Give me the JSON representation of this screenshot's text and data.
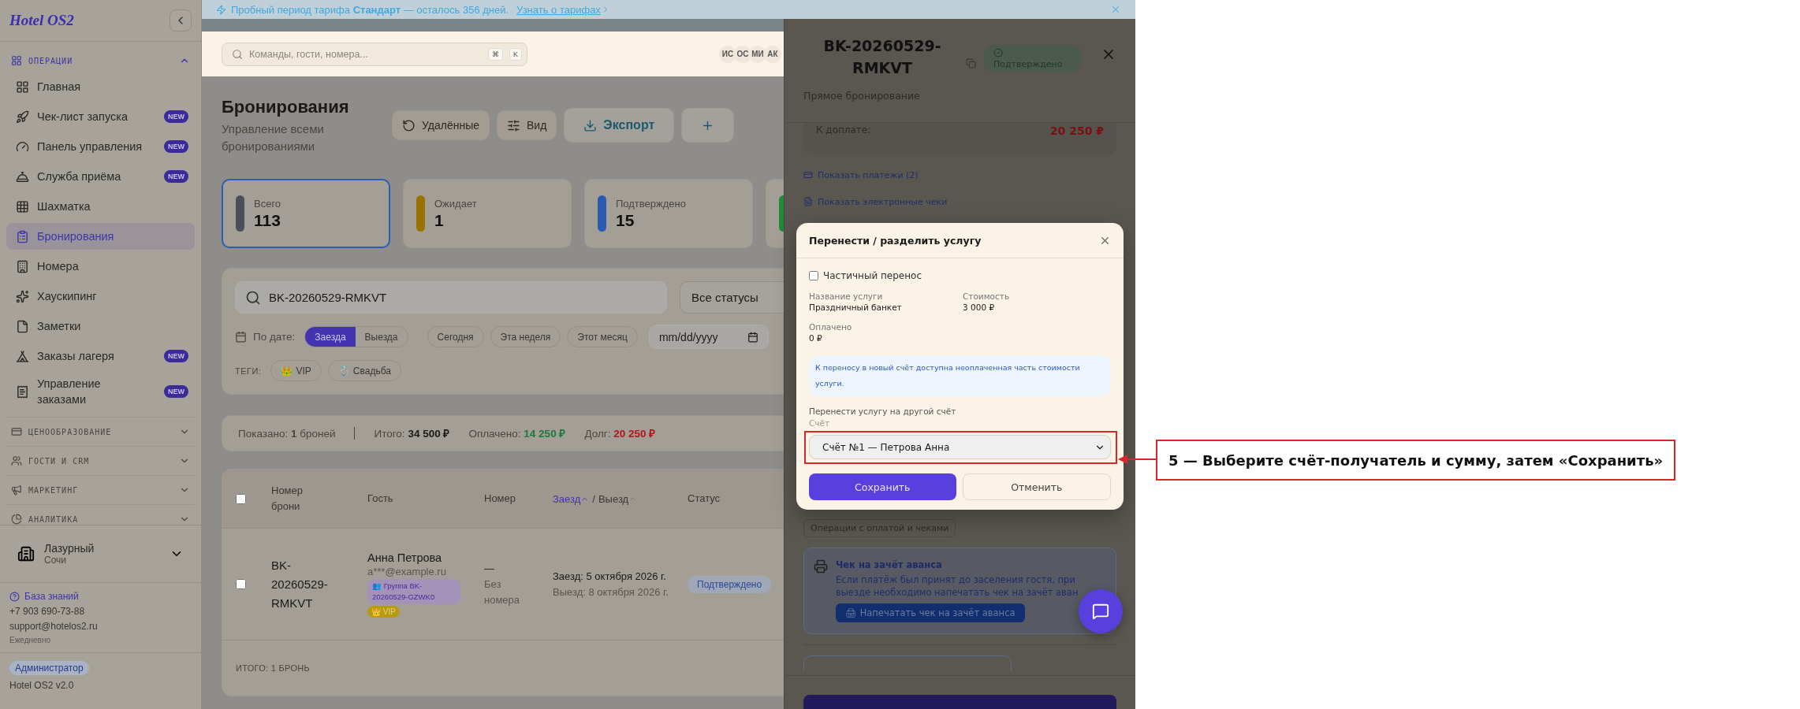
{
  "sidebar": {
    "logo": "Hotel OS2",
    "section": {
      "label": "ОПЕРАЦИИ",
      "expanded": true
    },
    "items": [
      {
        "label": "Главная",
        "selected": false
      },
      {
        "label": "Чек-лист запуска",
        "badge": "NEW",
        "selected": false
      },
      {
        "label": "Панель управления",
        "badge": "NEW",
        "selected": false
      },
      {
        "label": "Служба приёма",
        "badge": "NEW",
        "selected": false
      },
      {
        "label": "Шахматка",
        "selected": false
      },
      {
        "label": "Бронирования",
        "selected": true
      },
      {
        "label": "Номера",
        "selected": false
      },
      {
        "label": "Хаускипинг",
        "selected": false
      },
      {
        "label": "Заметки",
        "selected": false
      },
      {
        "label": "Заказы лагеря",
        "badge": "NEW",
        "selected": false
      },
      {
        "label": "Управление заказами",
        "badge": "NEW",
        "selected": false
      }
    ],
    "groups": [
      {
        "label": "ЦЕНООБРАЗОВАНИЕ",
        "expanded": false
      },
      {
        "label": "ГОСТИ И CRM",
        "expanded": false
      },
      {
        "label": "МАРКЕТИНГ",
        "expanded": false
      },
      {
        "label": "АНАЛИТИКА",
        "expanded": false
      }
    ],
    "property": {
      "name": "Лазурный",
      "city": "Сочи"
    },
    "help": {
      "link": "База знаний",
      "phone": "+7 903 690-73-88",
      "email": "support@hotelos2.ru",
      "hours": "Ежедневно"
    },
    "role": "Администратор",
    "version": "Hotel OS2 v2.0"
  },
  "banner": {
    "text": "Пробный период тарифа **Стандарт** — осталось 356 дней.",
    "link": "Узнать о тарифах"
  },
  "topbar": {
    "search_placeholder": "Команды, гости, номера...",
    "keys": [
      "⌘",
      "K"
    ],
    "avatars": [
      "ИС",
      "ОС",
      "МИ",
      "АК"
    ]
  },
  "page": {
    "title": "Бронирования",
    "subtitle": "Управление всеми бронированиями",
    "actions": [
      {
        "label": "Удалённые",
        "kind": "deleted"
      },
      {
        "label": "Вид",
        "kind": "view"
      },
      {
        "label": "Экспорт",
        "kind": "export"
      },
      {
        "kind": "add"
      }
    ]
  },
  "stats": [
    {
      "label": "Всего",
      "value": "113",
      "color": "#4a4f5a",
      "selected": true
    },
    {
      "label": "Ожидает",
      "value": "1",
      "color": "#9a7200",
      "selected": false
    },
    {
      "label": "Подтверждено",
      "value": "15",
      "color": "#2a5bb0",
      "selected": false
    },
    {
      "color": "#1f8a3a",
      "selected": false
    }
  ],
  "filters": {
    "search": "BK-20260529-RMKVT",
    "status": "Все статусы",
    "date_label": "По дате:",
    "date_modes": [
      {
        "label": "Заезда",
        "selected": true
      },
      {
        "label": "Выезда",
        "selected": false
      }
    ],
    "presets": [
      "Сегодня",
      "Эта неделя",
      "Этот месяц"
    ],
    "date_placeholder": "mm/dd/yyyy",
    "tags_label": "ТЕГИ:",
    "tags": [
      {
        "emoji": "👑",
        "label": "VIP"
      },
      {
        "emoji": "💍",
        "label": "Свадьба"
      }
    ]
  },
  "summary": {
    "shown": "Показано: **1** броней",
    "items": [
      {
        "label": "Итого:",
        "value": "34 500 ₽",
        "color": "#1a1a1a"
      },
      {
        "label": "Оплачено:",
        "value": "14 250 ₽",
        "color": "#1d7a3a"
      },
      {
        "label": "Долг:",
        "value": "20 250 ₽",
        "color": "#b5141c"
      }
    ]
  },
  "table": {
    "header_checked": false,
    "columns": [
      {
        "label": "Номер брони"
      },
      {
        "label": "Гость"
      },
      {
        "label": "Номер"
      },
      {
        "label": "Заезд",
        "sort": true,
        "active": true
      },
      {
        "label": "Выезд",
        "sort": true,
        "active": false
      },
      {
        "label": "Статус"
      }
    ],
    "sort_separator": "/",
    "rows": [
      {
        "checked": false,
        "booking": "BK-20260529-RMKVT",
        "guest": "Анна Петрова",
        "email": "a***@example.ru",
        "group": "👥 Группа BK-20260529-GZWK0",
        "tag": "👑 VIP",
        "room": "—",
        "room_note": "Без номера",
        "checkin": "Заезд: 5 октября 2026 г.",
        "checkout": "Выезд: 8 октября 2026 г.",
        "status": "Подтверждено"
      }
    ],
    "footer": "ИТОГО: 1 БРОНЬ"
  },
  "drawer": {
    "title": "BK-20260529-RMKVT",
    "status": "Подтверждено",
    "subtitle": "Прямое бронирование",
    "due": {
      "label": "К доплате:",
      "value": "20 250 ₽"
    },
    "links": [
      {
        "label": "Показать платежи (2)",
        "kind": "payments"
      },
      {
        "label": "Показать электронные чеки",
        "kind": "receipts"
      }
    ],
    "ops_label": "Операции с оплатой и чеками",
    "advance": {
      "title": "Чек на зачёт аванса",
      "text": "Если платёж был принят до заселения гостя, при выезде необходимо напечатать чек на зачёт аван",
      "button": "🖨 Напечатать чек на зачёт аванса"
    }
  },
  "modal": {
    "title": "Перенести / разделить услугу",
    "partial": {
      "label": "Частичный перенос",
      "checked": false
    },
    "fields": [
      {
        "label": "Название услуги",
        "value": "Праздничный банкет"
      },
      {
        "label": "Стоимость",
        "value": "3 000 ₽"
      },
      {
        "label": "Оплачено",
        "value": "0 ₽"
      }
    ],
    "info": "К переносу в новый счёт доступна неоплаченная часть стоимости услуги.",
    "section": "Перенести услугу на другой счёт",
    "select_label": "Счёт",
    "select_value": "Счёт №1 — Петрова Анна",
    "save": "Сохранить",
    "cancel": "Отменить"
  },
  "callout": {
    "step": "5 — Выберите счёт-получатель и сумму, затем «Сохранить»"
  }
}
